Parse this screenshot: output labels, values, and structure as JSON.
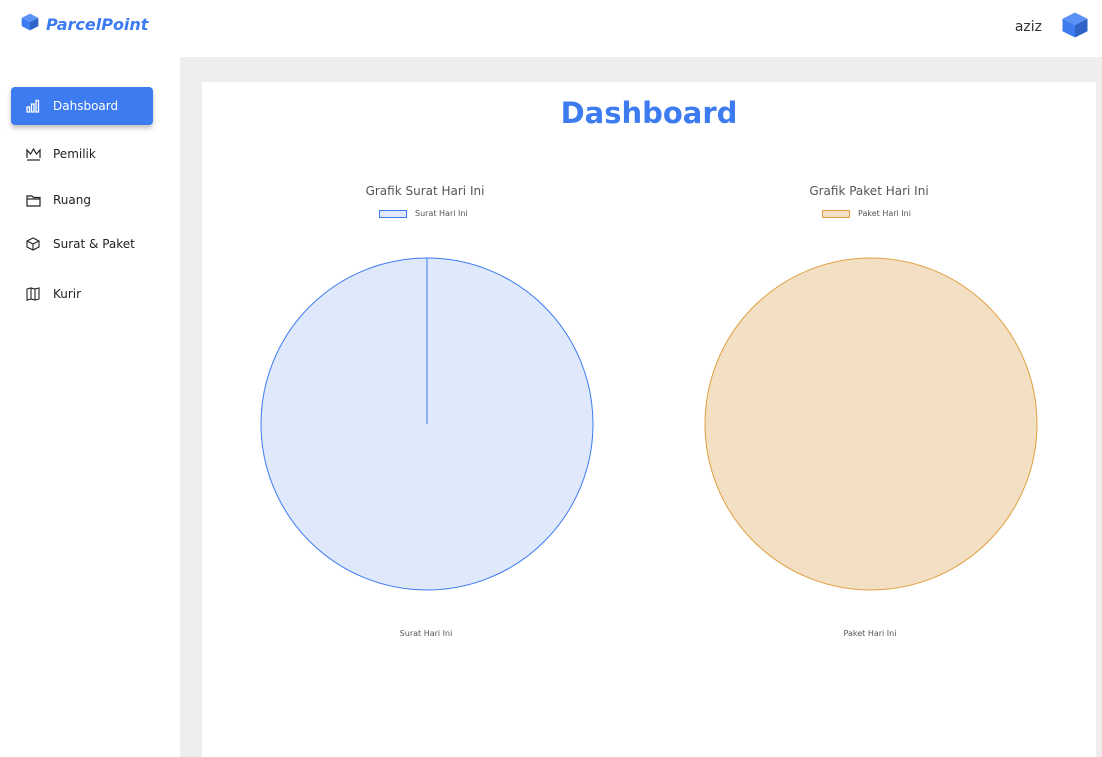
{
  "app": {
    "brand": "ParcelPoint",
    "user_name": "aziz",
    "accent_color": "#3d7bf0"
  },
  "sidebar": {
    "items": [
      {
        "label": "Dahsboard",
        "icon": "bar-chart-icon",
        "active": true
      },
      {
        "label": "Pemilik",
        "icon": "crown-icon",
        "active": false
      },
      {
        "label": "Ruang",
        "icon": "folder-icon",
        "active": false
      },
      {
        "label": "Surat & Paket",
        "icon": "package-icon",
        "active": false
      },
      {
        "label": "Kurir",
        "icon": "map-icon",
        "active": false
      }
    ]
  },
  "main": {
    "title": "Dashboard"
  },
  "chart_data": [
    {
      "type": "pie",
      "title": "Grafik Surat Hari Ini",
      "legend": [
        "Surat Hari Ini"
      ],
      "categories": [
        "Surat Hari Ini"
      ],
      "values": [
        1
      ],
      "fill_color": "#dfe9fb",
      "stroke_color": "#3d7bf0",
      "bottom_label": "Surat Hari Ini"
    },
    {
      "type": "pie",
      "title": "Grafik Paket Hari Ini",
      "legend": [
        "Paket Hari Ini"
      ],
      "categories": [
        "Paket Hari Ini"
      ],
      "values": [
        1
      ],
      "fill_color": "#f3dfc3",
      "stroke_color": "#e0a040",
      "bottom_label": "Paket Hari Ini"
    }
  ]
}
